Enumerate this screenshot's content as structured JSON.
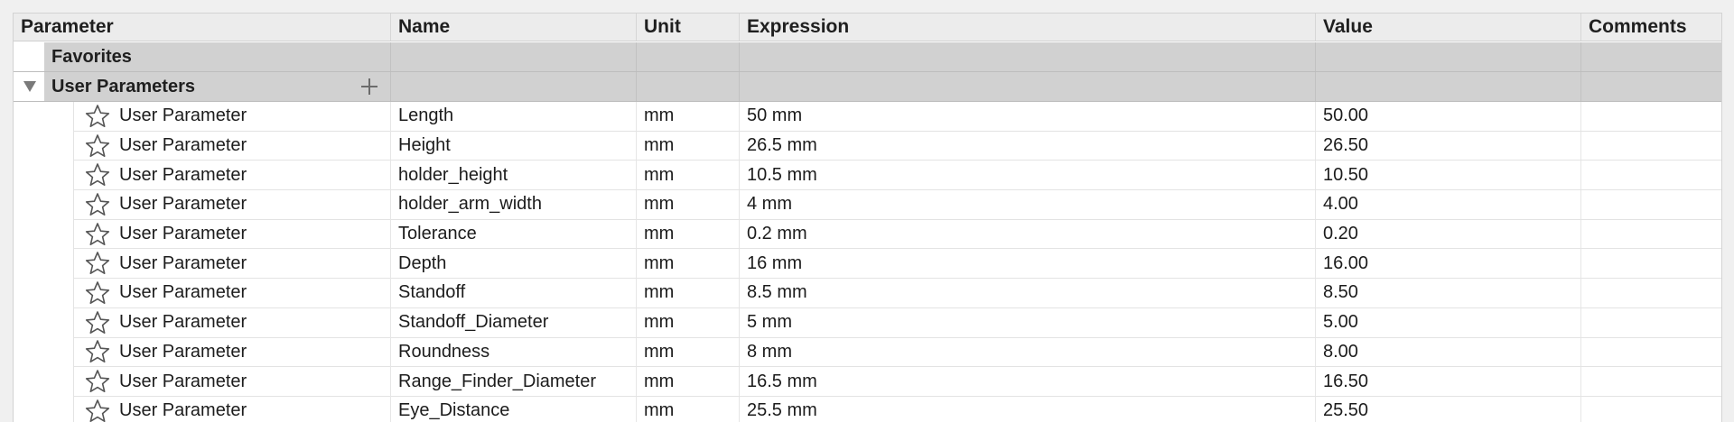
{
  "columns": {
    "parameter": "Parameter",
    "name": "Name",
    "unit": "Unit",
    "expression": "Expression",
    "value": "Value",
    "comments": "Comments"
  },
  "groups": {
    "favorites": {
      "label": "Favorites"
    },
    "user": {
      "label": "User Parameters",
      "expanded": true,
      "add_icon": "plus-icon"
    }
  },
  "rows": [
    {
      "type": "User Parameter",
      "name": "Length",
      "unit": "mm",
      "expression": "50 mm",
      "value": "50.00",
      "comment": ""
    },
    {
      "type": "User Parameter",
      "name": "Height",
      "unit": "mm",
      "expression": "26.5 mm",
      "value": "26.50",
      "comment": ""
    },
    {
      "type": "User Parameter",
      "name": "holder_height",
      "unit": "mm",
      "expression": "10.5 mm",
      "value": "10.50",
      "comment": ""
    },
    {
      "type": "User Parameter",
      "name": "holder_arm_width",
      "unit": "mm",
      "expression": "4 mm",
      "value": "4.00",
      "comment": ""
    },
    {
      "type": "User Parameter",
      "name": "Tolerance",
      "unit": "mm",
      "expression": "0.2 mm",
      "value": "0.20",
      "comment": ""
    },
    {
      "type": "User Parameter",
      "name": "Depth",
      "unit": "mm",
      "expression": "16 mm",
      "value": "16.00",
      "comment": ""
    },
    {
      "type": "User Parameter",
      "name": "Standoff",
      "unit": "mm",
      "expression": "8.5 mm",
      "value": "8.50",
      "comment": ""
    },
    {
      "type": "User Parameter",
      "name": "Standoff_Diameter",
      "unit": "mm",
      "expression": "5 mm",
      "value": "5.00",
      "comment": ""
    },
    {
      "type": "User Parameter",
      "name": "Roundness",
      "unit": "mm",
      "expression": "8 mm",
      "value": "8.00",
      "comment": ""
    },
    {
      "type": "User Parameter",
      "name": "Range_Finder_Diameter",
      "unit": "mm",
      "expression": "16.5 mm",
      "value": "16.50",
      "comment": ""
    },
    {
      "type": "User Parameter",
      "name": "Eye_Distance",
      "unit": "mm",
      "expression": "25.5 mm",
      "value": "25.50",
      "comment": ""
    }
  ],
  "icons": {
    "favorite": "star-outline-icon",
    "disclosure": "triangle-down-icon"
  }
}
